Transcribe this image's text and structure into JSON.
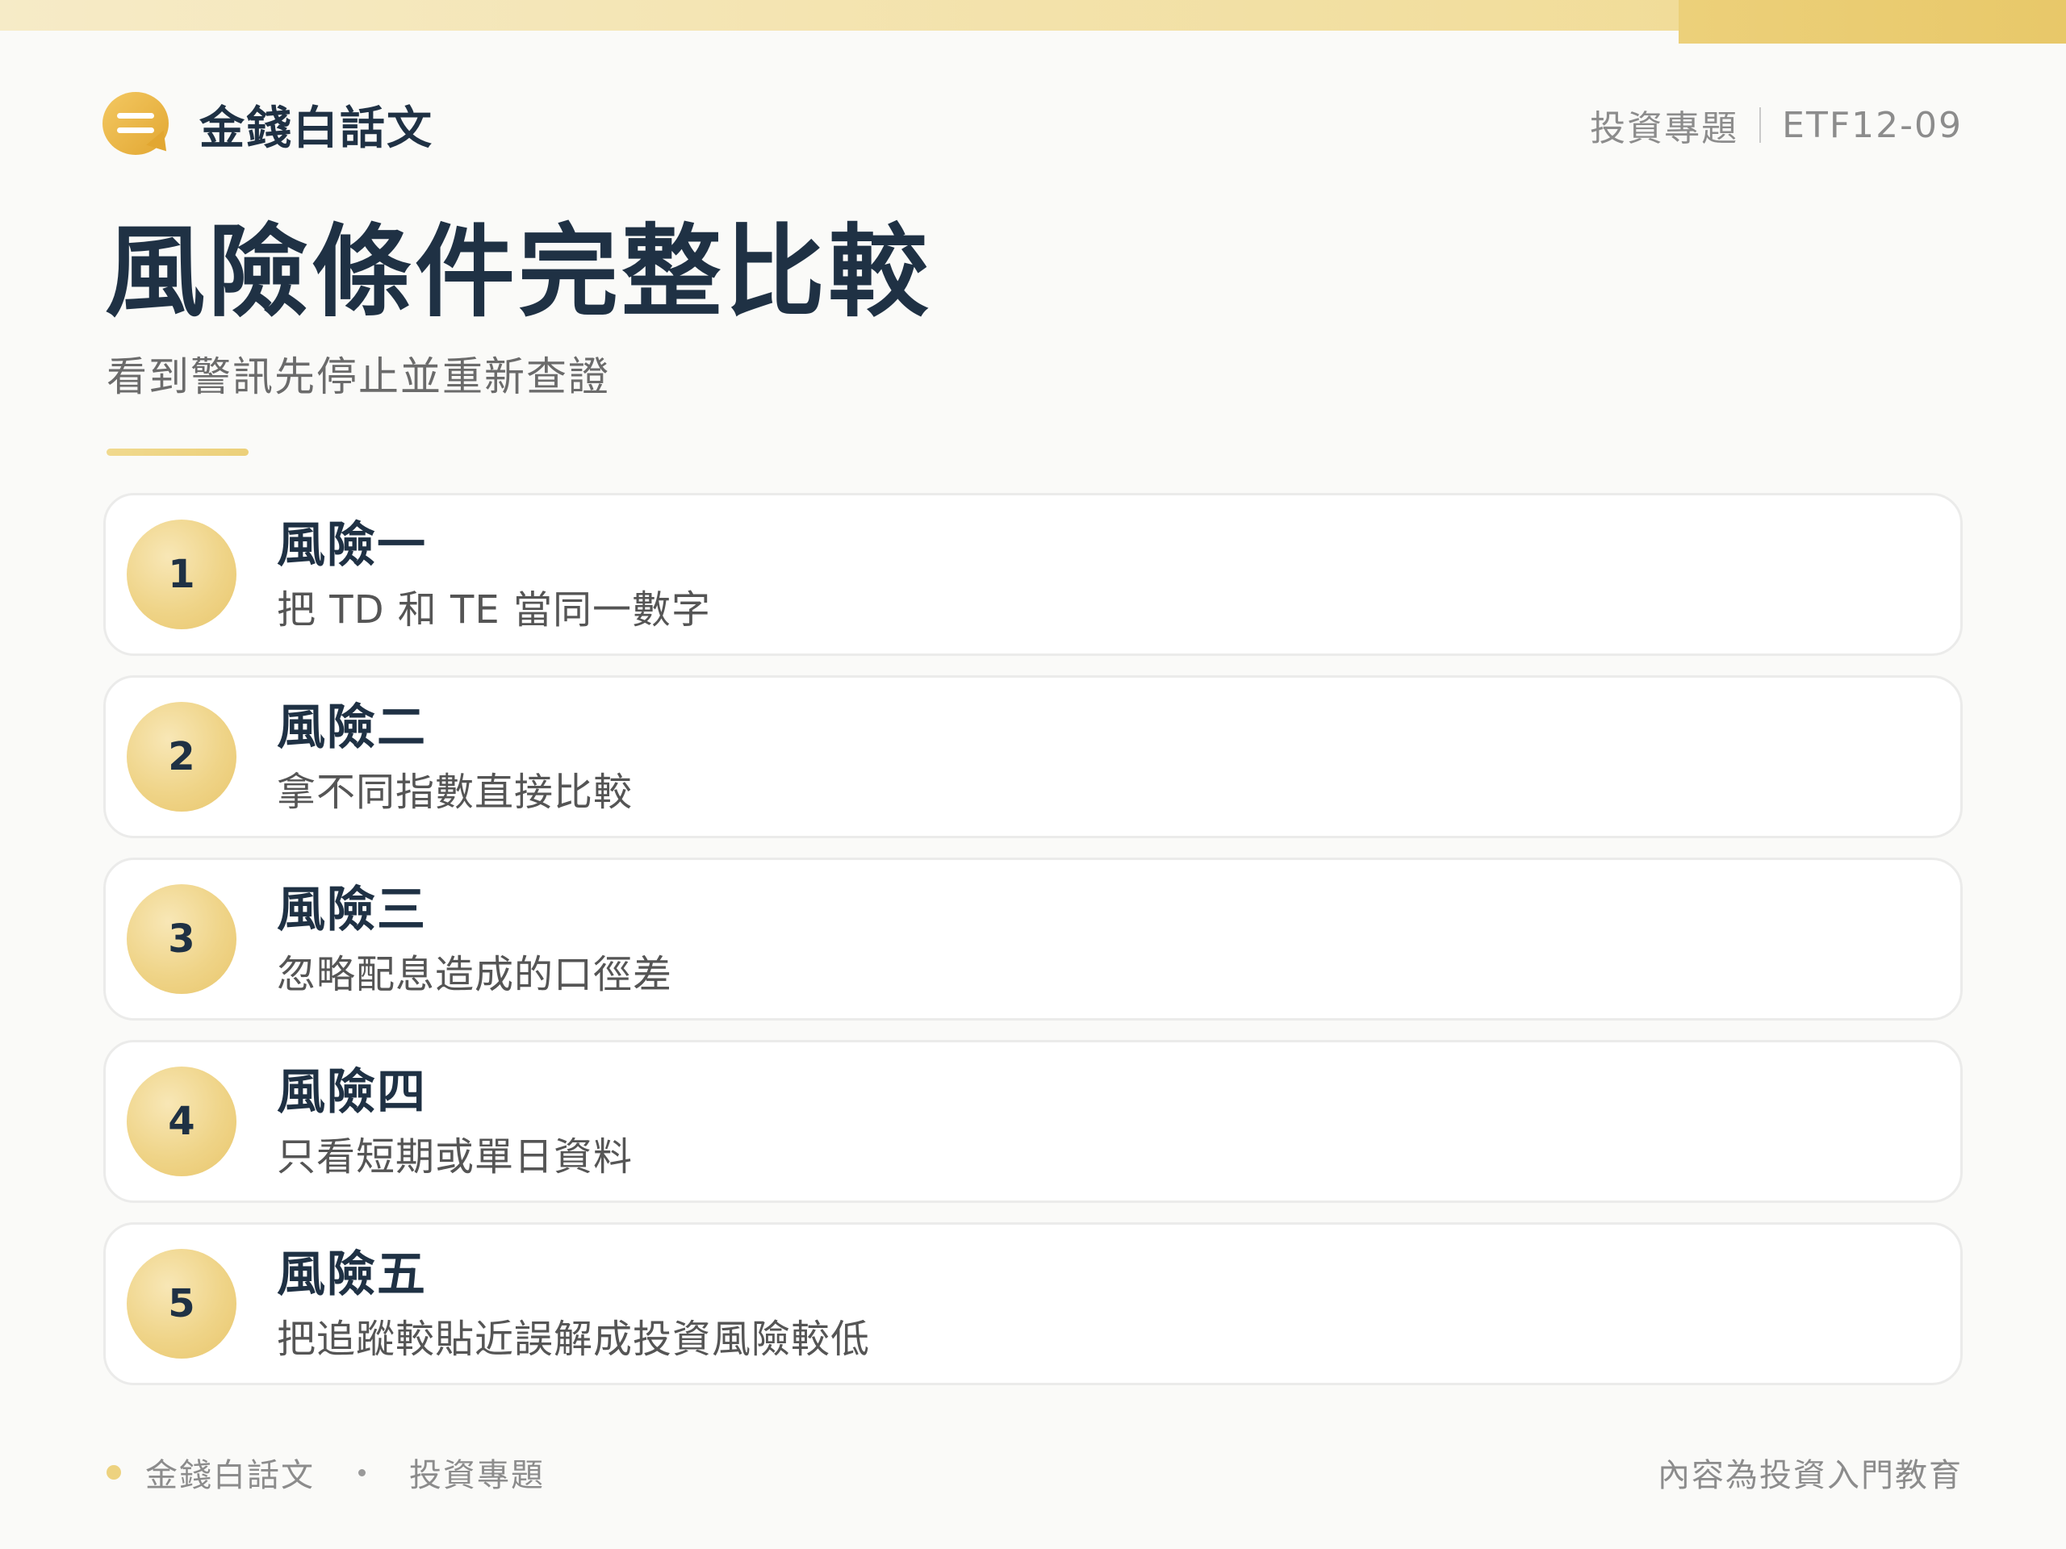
{
  "brand": {
    "name": "金錢白話文",
    "logo_icon": "chat-bubble-icon"
  },
  "meta": {
    "category": "投資專題",
    "code": "ETF12-09"
  },
  "title": "風險條件完整比較",
  "subtitle": "看到警訊先停止並重新查證",
  "risks": [
    {
      "number": "1",
      "title": "風險一",
      "description": "把 TD 和 TE 當同一數字"
    },
    {
      "number": "2",
      "title": "風險二",
      "description": "拿不同指數直接比較"
    },
    {
      "number": "3",
      "title": "風險三",
      "description": "忽略配息造成的口徑差"
    },
    {
      "number": "4",
      "title": "風險四",
      "description": "只看短期或單日資料"
    },
    {
      "number": "5",
      "title": "風險五",
      "description": "把追蹤較貼近誤解成投資風險較低"
    }
  ],
  "footer": {
    "brand": "金錢白話文",
    "category": "投資專題",
    "disclaimer": "內容為投資入門教育"
  },
  "colors": {
    "accent_gold": "#edd27f",
    "navy_text": "#1f3144",
    "muted_text": "#8c8c8c",
    "background": "#fafaf8"
  }
}
